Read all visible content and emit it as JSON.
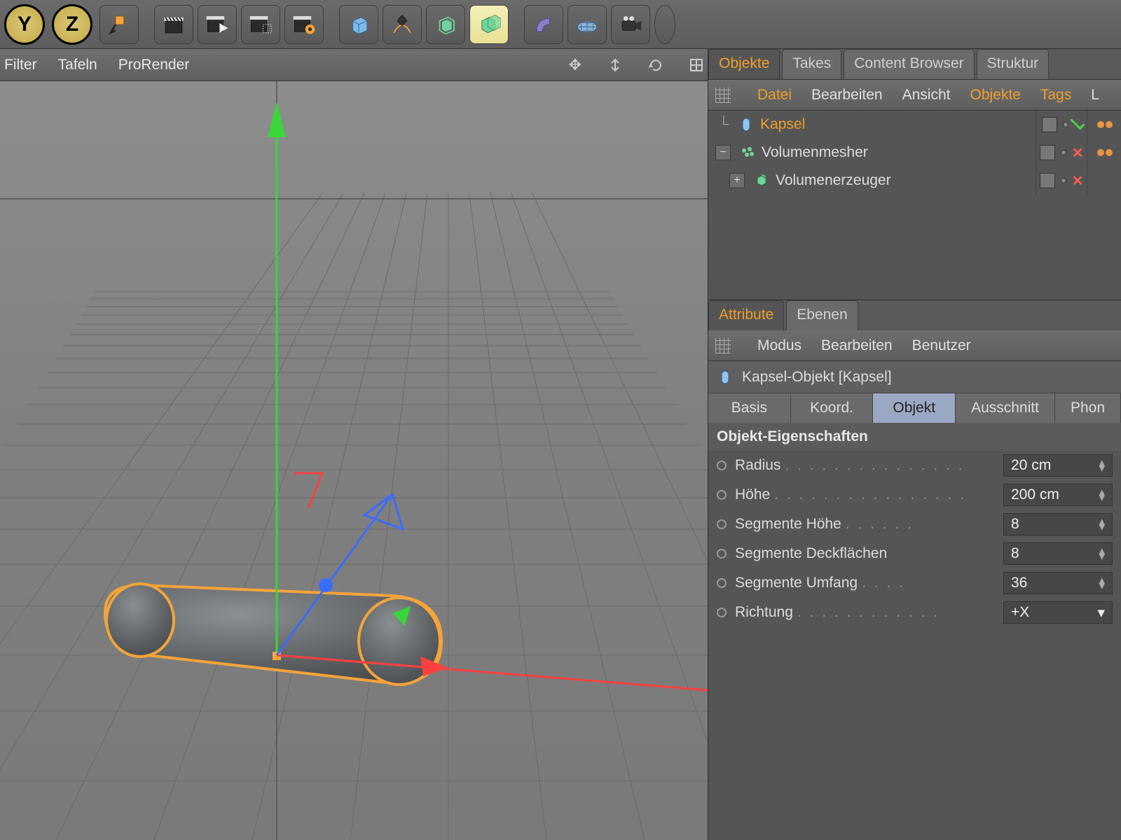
{
  "toolbar": {
    "rot_y": "Y",
    "rot_z": "Z"
  },
  "left_menu": {
    "filter": "Filter",
    "tafeln": "Tafeln",
    "prorender": "ProRender"
  },
  "right": {
    "tabs": {
      "objekte": "Objekte",
      "takes": "Takes",
      "content": "Content Browser",
      "struktur": "Struktur"
    },
    "obj_menu": {
      "datei": "Datei",
      "bearbeiten": "Bearbeiten",
      "ansicht": "Ansicht",
      "objekte": "Objekte",
      "tags": "Tags",
      "more": "L"
    },
    "tree": {
      "kapsel": "Kapsel",
      "volmesher": "Volumenmesher",
      "volgen": "Volumenerzeuger"
    },
    "attr_tabs": {
      "attribute": "Attribute",
      "ebenen": "Ebenen"
    },
    "attr_menu": {
      "modus": "Modus",
      "bearbeiten": "Bearbeiten",
      "benutzer": "Benutzer"
    },
    "obj_header": "Kapsel-Objekt [Kapsel]",
    "sub_tabs": {
      "basis": "Basis",
      "koord": "Koord.",
      "objekt": "Objekt",
      "ausschnitt": "Ausschnitt",
      "phong": "Phon"
    },
    "section": "Objekt-Eigenschaften",
    "props": {
      "radius_l": "Radius",
      "radius_v": "20 cm",
      "hoehe_l": "Höhe",
      "hoehe_v": "200 cm",
      "segh_l": "Segmente Höhe",
      "segh_v": "8",
      "segd_l": "Segmente Deckflächen",
      "segd_v": "8",
      "segu_l": "Segmente Umfang",
      "segu_v": "36",
      "dir_l": "Richtung",
      "dir_v": "+X"
    }
  }
}
